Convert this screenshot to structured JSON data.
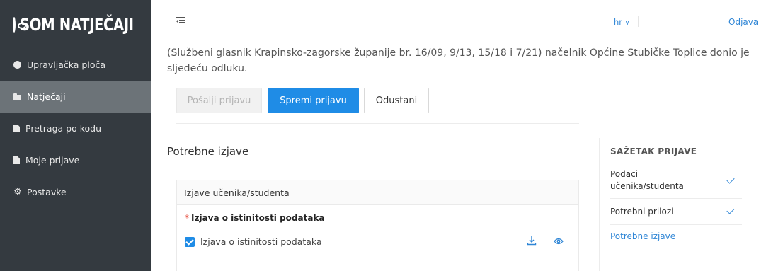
{
  "app": {
    "logo_text": "SOM NATJEČAJI"
  },
  "sidebar": {
    "items": [
      {
        "label": "Upravljačka ploča",
        "icon": "pie-chart-icon"
      },
      {
        "label": "Natječaji",
        "icon": "folder-icon",
        "active": true
      },
      {
        "label": "Pretraga po kodu",
        "icon": "file-icon"
      },
      {
        "label": "Moje prijave",
        "icon": "file-icon"
      },
      {
        "label": "Postavke",
        "icon": "gear-icon"
      }
    ]
  },
  "topbar": {
    "language": "hr",
    "logout_label": "Odjava"
  },
  "main": {
    "intro_text": "(Službeni glasnik Krapinsko-zagorske županije br. 16/09, 9/13, 15/18 i 7/21) načelnik Općine Stubičke Toplice donio je sljedeću odluku.",
    "buttons": {
      "send": "Pošalji prijavu",
      "save": "Spremi prijavu",
      "cancel": "Odustani"
    },
    "section_title": "Potrebne izjave",
    "panel": {
      "header": "Izjave učenika/studenta",
      "required_label": "Izjava o istinitosti podataka",
      "checkbox_label": "Izjava o istinitosti podataka",
      "checkbox_checked": true
    }
  },
  "summary": {
    "title": "SAŽETAK PRIJAVE",
    "items": [
      {
        "label": "Podaci učenika/studenta",
        "done": true
      },
      {
        "label": "Potrebni prilozi",
        "done": true
      },
      {
        "label": "Potrebne izjave",
        "done": false,
        "current": true
      }
    ]
  },
  "colors": {
    "sidebar_bg": "#343a40",
    "active_bg": "#6c7378",
    "accent": "#1f8ce6",
    "link": "#2f86d6",
    "required": "#e74c3c"
  }
}
